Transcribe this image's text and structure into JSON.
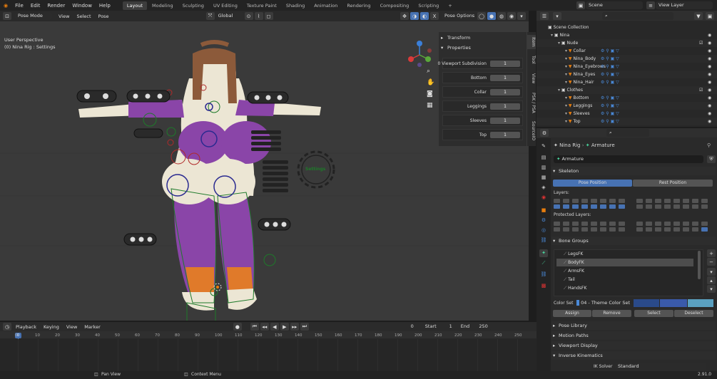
{
  "menu": [
    "File",
    "Edit",
    "Render",
    "Window",
    "Help"
  ],
  "workspaces": [
    "Layout",
    "Modeling",
    "Sculpting",
    "UV Editing",
    "Texture Paint",
    "Shading",
    "Animation",
    "Rendering",
    "Compositing",
    "Scripting"
  ],
  "scene": "Scene",
  "view_layer": "View Layer",
  "viewport": {
    "mode": "Pose Mode",
    "menus": [
      "View",
      "Select",
      "Pose"
    ],
    "transform": "Global",
    "pose_options": "Pose Options",
    "info_line1": "User Perspective",
    "info_line2": "(0) Nina Rig : Settings",
    "settings_gear_label": "Settings"
  },
  "npanel": {
    "transform": "Transform",
    "properties": "Properties",
    "tabs": [
      "Item",
      "Tool",
      "View",
      "PSK / PSA",
      "SourceIO"
    ],
    "rows": [
      {
        "label": "0 Viewport Subdivision",
        "value": "1"
      },
      {
        "label": "Bottom",
        "value": "1"
      },
      {
        "label": "Collar",
        "value": "1"
      },
      {
        "label": "Leggings",
        "value": "1"
      },
      {
        "label": "Sleeves",
        "value": "1"
      },
      {
        "label": "Top",
        "value": "1"
      }
    ]
  },
  "outliner": {
    "scene_collection": "Scene Collection",
    "items": [
      {
        "name": "Nina",
        "depth": 0
      },
      {
        "name": "Nude",
        "depth": 1
      },
      {
        "name": "Collar",
        "depth": 2
      },
      {
        "name": "Nina_Body",
        "depth": 2
      },
      {
        "name": "Nina_Eyebrows",
        "depth": 2
      },
      {
        "name": "Nina_Eyes",
        "depth": 2
      },
      {
        "name": "Nina_Hair",
        "depth": 2
      },
      {
        "name": "Clothes",
        "depth": 1
      },
      {
        "name": "Bottom",
        "depth": 2
      },
      {
        "name": "Leggings",
        "depth": 2
      },
      {
        "name": "Sleeves",
        "depth": 2
      },
      {
        "name": "Top",
        "depth": 2
      }
    ]
  },
  "props": {
    "breadcrumb_obj": "Nina Rig",
    "breadcrumb_data": "Armature",
    "name_field": "Armature",
    "skeleton": "Skeleton",
    "pose_position": "Pose Position",
    "rest_position": "Rest Position",
    "layers": "Layers:",
    "protected_layers": "Protected Layers:",
    "bone_groups": "Bone Groups",
    "bone_group_items": [
      "LegsFK",
      "BodyFK",
      "ArmsFK",
      "Tail",
      "HandsFK"
    ],
    "selected_group": "BodyFK",
    "color_set_label": "Color Set:",
    "color_set": "04 - Theme Color Set",
    "assign": "Assign",
    "remove": "Remove",
    "select": "Select",
    "deselect": "Deselect",
    "sections": [
      "Pose Library",
      "Motion Paths",
      "Viewport Display",
      "Inverse Kinematics"
    ],
    "ik_solver_label": "IK Solver",
    "ik_solver": "Standard",
    "version": "2.91.0"
  },
  "timeline": {
    "menus": [
      "Playback",
      "Keying",
      "View",
      "Marker"
    ],
    "current": "0",
    "start_label": "Start",
    "start": "1",
    "end_label": "End",
    "end": "250",
    "ticks": [
      "0",
      "10",
      "20",
      "30",
      "40",
      "50",
      "60",
      "70",
      "80",
      "90",
      "100",
      "110",
      "120",
      "130",
      "140",
      "150",
      "160",
      "170",
      "180",
      "190",
      "200",
      "210",
      "220",
      "230",
      "240",
      "250"
    ]
  },
  "status": {
    "pan": "Pan View",
    "context": "Context Menu"
  },
  "colors": {
    "accent": "#4772b3",
    "bg": "#3a3a3a"
  }
}
